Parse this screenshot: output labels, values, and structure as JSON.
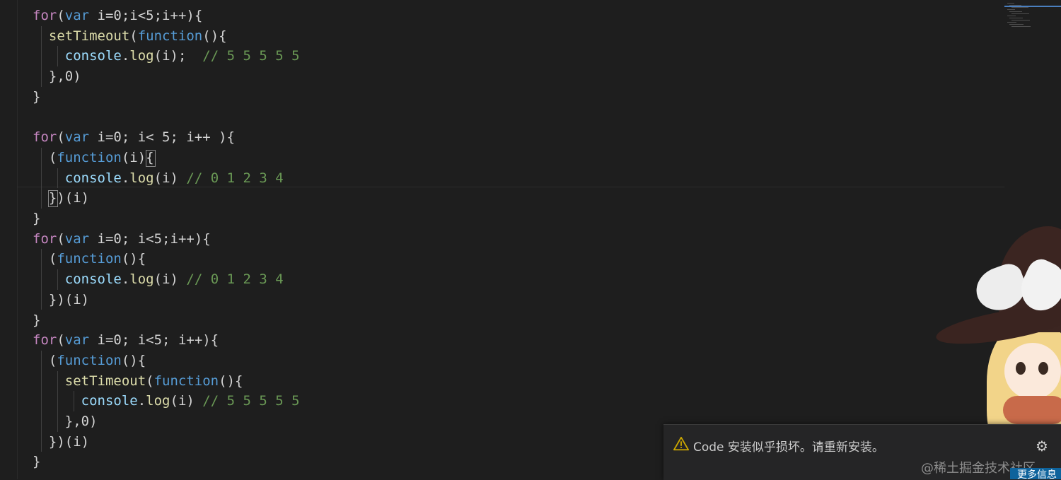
{
  "editor": {
    "lines": [
      {
        "tokens": [
          [
            "kw",
            "for"
          ],
          [
            "p",
            "("
          ],
          [
            "storage",
            "var"
          ],
          [
            "p",
            " i=0;i<5;i++){"
          ]
        ]
      },
      {
        "tokens": [
          [
            "p",
            "  "
          ],
          [
            "fn",
            "setTimeout"
          ],
          [
            "p",
            "("
          ],
          [
            "storage",
            "function"
          ],
          [
            "p",
            "(){"
          ]
        ]
      },
      {
        "tokens": [
          [
            "p",
            "    "
          ],
          [
            "var",
            "console"
          ],
          [
            "p",
            "."
          ],
          [
            "fn",
            "log"
          ],
          [
            "p",
            "(i);  "
          ],
          [
            "cmt",
            "// 5 5 5 5 5"
          ]
        ]
      },
      {
        "tokens": [
          [
            "p",
            "  },0)"
          ]
        ]
      },
      {
        "tokens": [
          [
            "p",
            "}"
          ]
        ]
      },
      {
        "tokens": [
          [
            "p",
            ""
          ]
        ]
      },
      {
        "tokens": [
          [
            "kw",
            "for"
          ],
          [
            "p",
            "("
          ],
          [
            "storage",
            "var"
          ],
          [
            "p",
            " i=0; i< 5; i++ ){"
          ]
        ]
      },
      {
        "tokens": [
          [
            "p",
            "  ("
          ],
          [
            "storage",
            "function"
          ],
          [
            "p",
            "(i){"
          ]
        ]
      },
      {
        "tokens": [
          [
            "p",
            "    "
          ],
          [
            "var",
            "console"
          ],
          [
            "p",
            "."
          ],
          [
            "fn",
            "log"
          ],
          [
            "p",
            "(i) "
          ],
          [
            "cmt",
            "// 0 1 2 3 4"
          ]
        ]
      },
      {
        "tokens": [
          [
            "p",
            "  })(i)"
          ]
        ]
      },
      {
        "tokens": [
          [
            "p",
            "}"
          ]
        ]
      },
      {
        "tokens": [
          [
            "kw",
            "for"
          ],
          [
            "p",
            "("
          ],
          [
            "storage",
            "var"
          ],
          [
            "p",
            " i=0; i<5;i++){"
          ]
        ]
      },
      {
        "tokens": [
          [
            "p",
            "  ("
          ],
          [
            "storage",
            "function"
          ],
          [
            "p",
            "(){"
          ]
        ]
      },
      {
        "tokens": [
          [
            "p",
            "    "
          ],
          [
            "var",
            "console"
          ],
          [
            "p",
            "."
          ],
          [
            "fn",
            "log"
          ],
          [
            "p",
            "(i) "
          ],
          [
            "cmt",
            "// 0 1 2 3 4"
          ]
        ]
      },
      {
        "tokens": [
          [
            "p",
            "  })(i)"
          ]
        ]
      },
      {
        "tokens": [
          [
            "p",
            "}"
          ]
        ]
      },
      {
        "tokens": [
          [
            "kw",
            "for"
          ],
          [
            "p",
            "("
          ],
          [
            "storage",
            "var"
          ],
          [
            "p",
            " i=0; i<5; i++){"
          ]
        ]
      },
      {
        "tokens": [
          [
            "p",
            "  ("
          ],
          [
            "storage",
            "function"
          ],
          [
            "p",
            "(){"
          ]
        ]
      },
      {
        "tokens": [
          [
            "p",
            "    "
          ],
          [
            "fn",
            "setTimeout"
          ],
          [
            "p",
            "("
          ],
          [
            "storage",
            "function"
          ],
          [
            "p",
            "(){"
          ]
        ]
      },
      {
        "tokens": [
          [
            "p",
            "      "
          ],
          [
            "var",
            "console"
          ],
          [
            "p",
            "."
          ],
          [
            "fn",
            "log"
          ],
          [
            "p",
            "(i) "
          ],
          [
            "cmt",
            "// 5 5 5 5 5"
          ]
        ]
      },
      {
        "tokens": [
          [
            "p",
            "    },0)"
          ]
        ]
      },
      {
        "tokens": [
          [
            "p",
            "  })(i)"
          ]
        ]
      },
      {
        "tokens": [
          [
            "p",
            "}"
          ]
        ]
      }
    ]
  },
  "notification": {
    "message": "Code 安装似乎损坏。请重新安装。",
    "warning_icon": "warning-icon",
    "settings_icon": "gear-icon",
    "more_button": "更多信息"
  },
  "watermark": "@稀土掘金技术社区",
  "colors": {
    "background": "#1e1e1e",
    "keyword": "#c586c0",
    "storage": "#569cd6",
    "function": "#dcdcaa",
    "variable": "#9cdcfe",
    "comment": "#6a9955",
    "notification_bg": "#252526",
    "warning": "#cca700"
  }
}
